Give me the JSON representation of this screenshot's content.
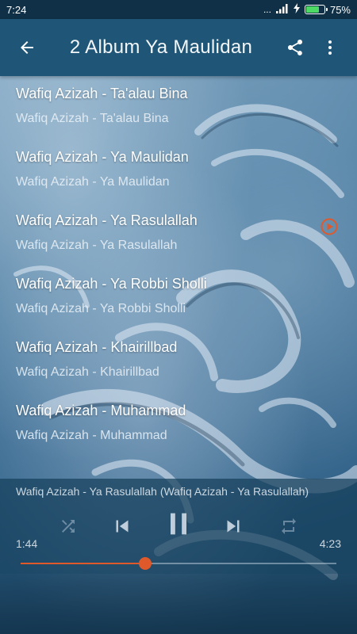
{
  "status_bar": {
    "time": "7:24",
    "indicators": "...",
    "battery_percent": "75%",
    "battery_level": 0.75,
    "battery_color": "#4cd964"
  },
  "toolbar": {
    "title": "2 Album Ya Maulidan",
    "back_icon": "arrow-left-icon",
    "share_icon": "share-icon",
    "menu_icon": "more-vert-icon"
  },
  "tracks": [
    {
      "title": "Wafiq Azizah - Ta'alau Bina",
      "subtitle": "Wafiq Azizah - Ta'alau Bina"
    },
    {
      "title": "Wafiq Azizah - Ya Maulidan",
      "subtitle": "Wafiq Azizah - Ya Maulidan"
    },
    {
      "title": "Wafiq Azizah - Ya Rasulallah",
      "subtitle": "Wafiq Azizah - Ya Rasulallah",
      "playing": true
    },
    {
      "title": "Wafiq Azizah - Ya Robbi Sholli",
      "subtitle": "Wafiq Azizah - Ya Robbi Sholli"
    },
    {
      "title": "Wafiq Azizah - Khairillbad",
      "subtitle": "Wafiq Azizah - Khairillbad"
    },
    {
      "title": "Wafiq Azizah - Muhammad",
      "subtitle": "Wafiq Azizah - Muhammad"
    }
  ],
  "player": {
    "now_playing": "Wafiq Azizah - Ya Rasulallah (Wafiq Azizah - Ya Rasulallah)",
    "current_time": "1:44",
    "total_time": "4:23",
    "progress": 0.395,
    "accent_color": "#e0592a",
    "controls": [
      "shuffle-icon",
      "skip-previous-icon",
      "pause-icon",
      "skip-next-icon",
      "repeat-icon"
    ]
  }
}
